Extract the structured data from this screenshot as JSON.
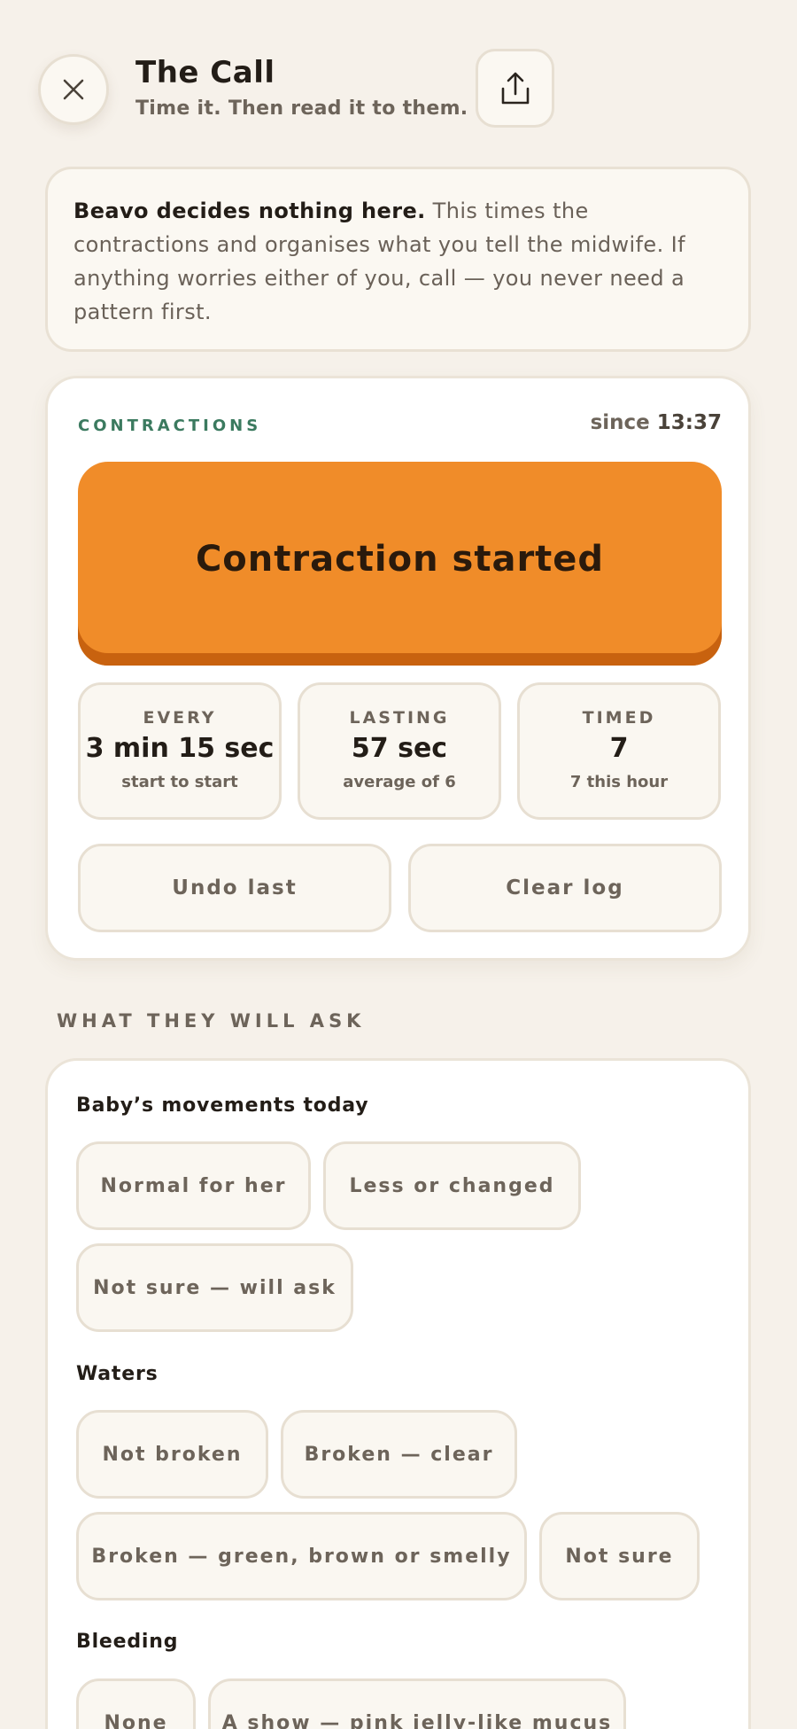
{
  "header": {
    "title": "The Call",
    "subtitle": "Time it. Then read it to them."
  },
  "notice": {
    "bold": "Beavo decides nothing here.",
    "text": " This times the contractions and organises what you tell the midwife. If anything worries either of you, call — you never need a pattern first."
  },
  "contractions": {
    "label": "CONTRACTIONS",
    "since_label": "since",
    "since_time": "13:37",
    "button_label": "Contraction started",
    "stats": [
      {
        "label": "EVERY",
        "value": "3 min 15 sec",
        "sub": "start to start"
      },
      {
        "label": "LASTING",
        "value": "57 sec",
        "sub": "average of 6"
      },
      {
        "label": "TIMED",
        "value": "7",
        "sub": "7 this hour"
      }
    ],
    "undo_label": "Undo last",
    "clear_label": "Clear log"
  },
  "questions": {
    "section_title": "WHAT THEY WILL ASK",
    "movements": {
      "label": "Baby’s movements today",
      "options": [
        "Normal for her",
        "Less or changed",
        "Not sure — will ask"
      ]
    },
    "waters": {
      "label": "Waters",
      "options": [
        "Not broken",
        "Broken — clear",
        "Broken — green, brown or smelly",
        "Not sure"
      ]
    },
    "bleeding": {
      "label": "Bleeding",
      "options": [
        "None",
        "A show — pink jelly-like mucus"
      ]
    }
  },
  "colors": {
    "accent": "#f08c29",
    "accent_shadow": "#c8620f",
    "label_green": "#3b7a5f",
    "background": "#f6f1ea"
  },
  "icons": {
    "close": "close-icon",
    "share": "share-icon"
  }
}
